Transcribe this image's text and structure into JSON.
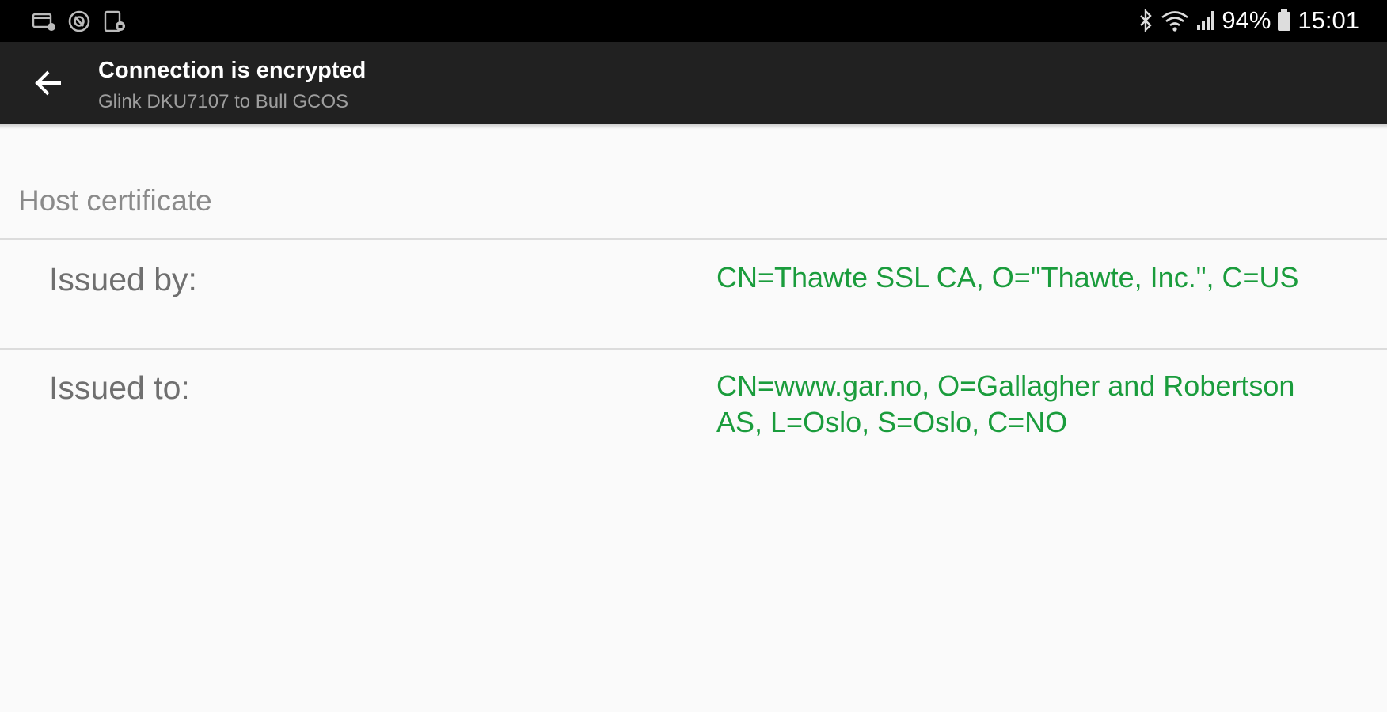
{
  "status_bar": {
    "left_icons": [
      "screen-record-icon",
      "sync-icon",
      "document-lock-icon"
    ],
    "right_icons": [
      "bluetooth-icon",
      "wifi-icon",
      "signal-icon",
      "battery-icon"
    ],
    "battery": "94%",
    "time": "15:01"
  },
  "app_bar": {
    "back_icon": "arrow-back-icon",
    "title": "Connection is encrypted",
    "subtitle": "Glink  DKU7107 to Bull GCOS"
  },
  "certificate": {
    "section_title": "Host certificate",
    "rows": [
      {
        "label": "Issued by:",
        "value": "CN=Thawte SSL CA, O=\"Thawte, Inc.\", C=US"
      },
      {
        "label": "Issued to:",
        "value": "CN=www.gar.no, O=Gallagher and Robertson AS, L=Oslo, S=Oslo, C=NO"
      }
    ]
  },
  "colors": {
    "status_bar_bg": "#000000",
    "app_bar_bg": "#212121",
    "page_bg": "#fafafa",
    "value_text": "#1a9c3c",
    "label_text": "#6f6f6f"
  }
}
